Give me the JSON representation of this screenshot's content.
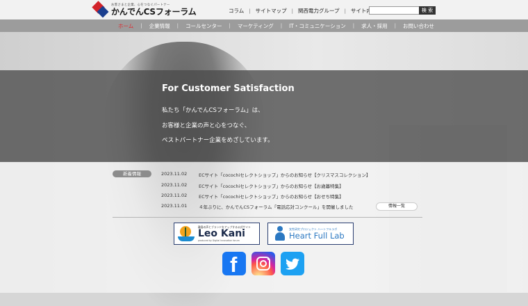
{
  "header": {
    "logo_tagline": "お客さまと企業、心をつなぐパートナー",
    "logo_name": "かんでんCSフォーラム",
    "nav": [
      "コラム",
      "サイトマップ",
      "関西電力グループ"
    ],
    "search_label": "サイト内検索",
    "search_button": "検 索"
  },
  "main_nav": {
    "items": [
      "ホーム",
      "企業情報",
      "コールセンター",
      "マーケティング",
      "IT・コミュニケーション",
      "求人・採用",
      "お問い合わせ"
    ],
    "active_index": 0,
    "active_color": "#e0272d"
  },
  "hero": {
    "title": "For Customer Satisfaction",
    "lines": [
      "私たち「かんでんCSフォーラム」は、",
      "お客様と企業の声と心をつなぐ、",
      "ベストパートナー企業をめざしています。"
    ]
  },
  "news": {
    "badge": "新着情報",
    "items": [
      {
        "date": "2023.11.02",
        "text": "ECサイト「cocochiセレクトショップ」からのお知らせ【クリスマスコレクション】"
      },
      {
        "date": "2023.11.02",
        "text": "ECサイト「cocochiセレクトショップ」からのお知らせ【お歳暮特集】"
      },
      {
        "date": "2023.11.02",
        "text": "ECサイト「cocochiセレクトショップ」からのお知らせ【おせち特集】"
      },
      {
        "date": "2023.11.01",
        "text": "４年ぶりに、かんでんCSフォーラム「電話応対コンクール」を開催しました"
      }
    ],
    "more_button": "情報一覧"
  },
  "banners": {
    "leokani": {
      "small": "離島の声とブランドをアップする公式サイト",
      "name": "Leo Kani",
      "sub": "produced by Digital Innovation forum"
    },
    "hfl": {
      "small": "女性研究プロジェクト ハートフルラボ",
      "name": "Heart Full Lab"
    }
  },
  "social": {
    "facebook_icon": "facebook-icon",
    "instagram_icon": "instagram-icon",
    "twitter_icon": "twitter-icon"
  }
}
